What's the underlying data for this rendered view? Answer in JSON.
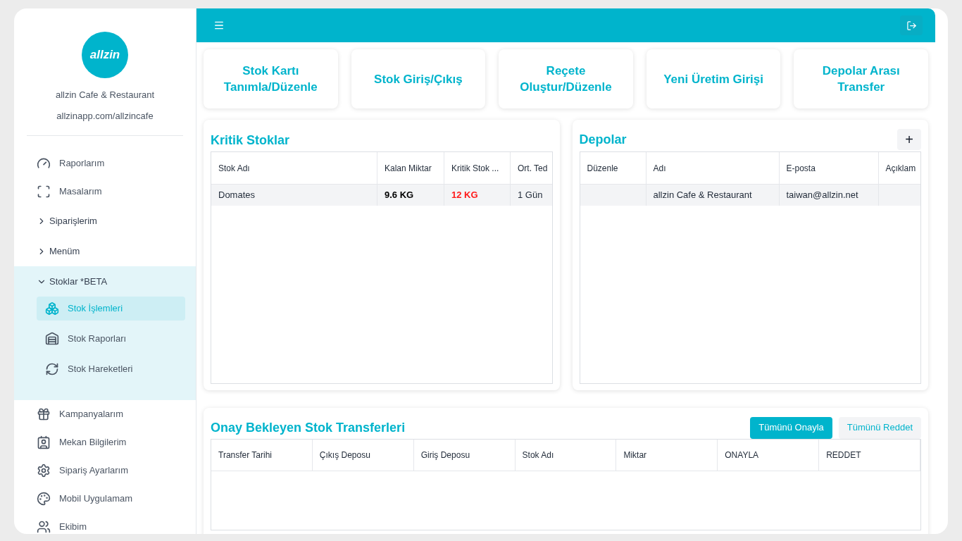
{
  "brand": {
    "logo_text": "allzin",
    "name": "allzin Cafe & Restaurant",
    "url": "allzinapp.com/allzincafe"
  },
  "sidebar": {
    "items": [
      {
        "kind": "link",
        "label": "Raporlarım",
        "selected": false
      },
      {
        "kind": "link",
        "label": "Masalarım",
        "selected": false
      },
      {
        "kind": "group",
        "label": "Siparişlerim",
        "expanded": false
      },
      {
        "kind": "group",
        "label": "Menüm",
        "expanded": false
      },
      {
        "kind": "group",
        "label": "Stoklar *BETA",
        "expanded": true,
        "children": [
          {
            "label": "Stok İşlemleri",
            "selected": true
          },
          {
            "label": "Stok Raporları",
            "selected": false
          },
          {
            "label": "Stok Hareketleri",
            "selected": false
          }
        ]
      },
      {
        "kind": "link",
        "label": "Kampanyalarım",
        "selected": false
      },
      {
        "kind": "link",
        "label": "Mekan Bilgilerim",
        "selected": false
      },
      {
        "kind": "link",
        "label": "Sipariş Ayarlarım",
        "selected": false
      },
      {
        "kind": "link",
        "label": "Mobil Uygulamam",
        "selected": false
      },
      {
        "kind": "link",
        "label": "Ekibim",
        "selected": false
      }
    ]
  },
  "actions": [
    "Stok Kartı Tanımla/Düzenle",
    "Stok Giriş/Çıkış",
    "Reçete Oluştur/Düzenle",
    "Yeni Üretim Girişi",
    "Depolar Arası Transfer"
  ],
  "critical_stocks": {
    "title": "Kritik Stoklar",
    "columns": [
      "Stok Adı",
      "Kalan Miktar",
      "Kritik Stok ...",
      "Ort. Ted"
    ],
    "rows": [
      [
        "Domates",
        "9.6 KG",
        "12 KG",
        "1 Gün"
      ]
    ]
  },
  "warehouses": {
    "title": "Depolar",
    "add_label": "+",
    "columns": [
      "Düzenle",
      "Adı",
      "E-posta",
      "Açıklam"
    ],
    "rows": [
      [
        "",
        "allzin Cafe & Restaurant",
        "taiwan@allzin.net",
        ""
      ]
    ]
  },
  "transfers": {
    "title": "Onay Bekleyen Stok Transferleri",
    "approve_all": "Tümünü Onayla",
    "reject_all": "Tümünü Reddet",
    "columns": [
      "Transfer Tarihi",
      "Çıkış Deposu",
      "Giriş Deposu",
      "Stok Adı",
      "Miktar",
      "ONAYLA",
      "REDDET"
    ]
  }
}
